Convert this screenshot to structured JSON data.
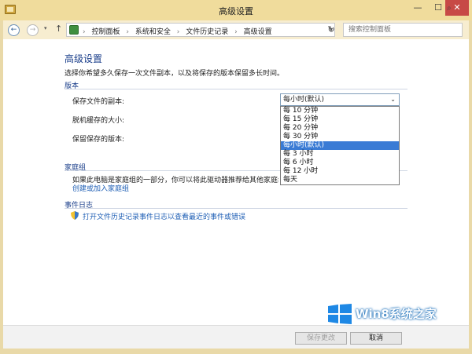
{
  "window": {
    "title": "高级设置",
    "min": "—",
    "max": "☐",
    "close": "✕"
  },
  "nav": {
    "back": "←",
    "forward": "→",
    "recent": "▾",
    "up": "↑",
    "breadcrumbs": [
      "控制面板",
      "系统和安全",
      "文件历史记录",
      "高级设置"
    ],
    "crumb_sep": "›",
    "address_dropdown": "▾",
    "refresh": "↻",
    "search_placeholder": "搜索控制面板",
    "search_icon": "⌕"
  },
  "page": {
    "title": "高级设置",
    "description": "选择你希望多久保存一次文件副本，以及将保存的版本保留多长时间。"
  },
  "versions": {
    "group_title": "版本",
    "save_copies_label": "保存文件的副本:",
    "offline_cache_label": "脱机缓存的大小:",
    "keep_versions_label": "保留保存的版本:",
    "selected_value": "每小时(默认)",
    "arrow": "⌄",
    "options": [
      "每 10 分钟",
      "每 15 分钟",
      "每 20 分钟",
      "每 30 分钟",
      "每小时(默认)",
      "每 3 小时",
      "每 6 小时",
      "每 12 小时",
      "每天"
    ],
    "selected_index": 4
  },
  "homegroup": {
    "group_title": "家庭组",
    "description": "如果此电脑是家庭组的一部分，你可以将此驱动器推荐给其他家庭组成员",
    "link": "创建或加入家庭组"
  },
  "events": {
    "group_title": "事件日志",
    "link": "打开文件历史记录事件日志以查看最近的事件或错误"
  },
  "footer": {
    "save": "保存更改",
    "cancel": "取消"
  },
  "watermark": {
    "text": "Win8系统之家"
  },
  "colors": {
    "accent": "#1a3e8a",
    "link": "#1f5fb5",
    "selection": "#3a7bd5",
    "close": "#c74a46"
  }
}
